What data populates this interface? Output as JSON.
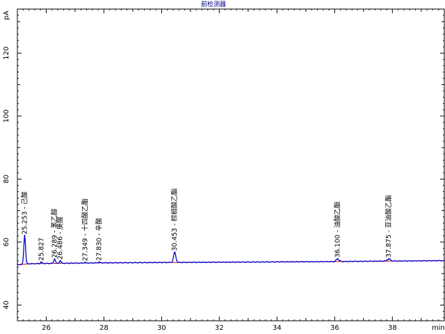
{
  "chart_data": {
    "type": "line",
    "title": "前检测器",
    "xlabel": "min",
    "ylabel": "pA",
    "xlim": [
      25.0,
      39.8
    ],
    "ylim": [
      35.0,
      134.0
    ],
    "x_ticks": [
      26,
      28,
      30,
      32,
      34,
      36,
      38
    ],
    "y_ticks": [
      40,
      60,
      80,
      100,
      120
    ],
    "grid": false,
    "series_color": "#0000cc",
    "peaks": [
      {
        "rt": 25.253,
        "label": "25.253 - 己酸",
        "height": 62.0,
        "width": 0.03
      },
      {
        "rt": 25.827,
        "label": "25.827",
        "height": 53.6,
        "width": 0.03
      },
      {
        "rt": 26.289,
        "label": "26.289 - 苯乙醇",
        "height": 54.5,
        "width": 0.03
      },
      {
        "rt": 26.486,
        "label": "26.486 - 庚酸",
        "height": 54.0,
        "width": 0.03
      },
      {
        "rt": 27.349,
        "label": "27.349 - 十四酸乙酯",
        "height": 53.5,
        "width": 0.03
      },
      {
        "rt": 27.83,
        "label": "27.830 - 辛酸",
        "height": 53.6,
        "width": 0.03
      },
      {
        "rt": 30.453,
        "label": "30.453 - 棕榈酸乙酯",
        "height": 56.7,
        "width": 0.04
      },
      {
        "rt": 36.1,
        "label": "36.100 - 油酸乙酯",
        "height": 54.6,
        "width": 0.05
      },
      {
        "rt": 37.875,
        "label": "37.875 - 亚油酸乙酯",
        "height": 54.6,
        "width": 0.06
      }
    ],
    "baseline": [
      [
        25.0,
        52.8
      ],
      [
        25.15,
        52.9
      ],
      [
        25.4,
        53.1
      ],
      [
        26.0,
        53.2
      ],
      [
        28.0,
        53.4
      ],
      [
        30.0,
        53.5
      ],
      [
        32.0,
        53.6
      ],
      [
        34.0,
        53.7
      ],
      [
        36.0,
        53.8
      ],
      [
        37.0,
        53.9
      ],
      [
        38.5,
        54.0
      ],
      [
        39.8,
        54.1
      ]
    ]
  }
}
